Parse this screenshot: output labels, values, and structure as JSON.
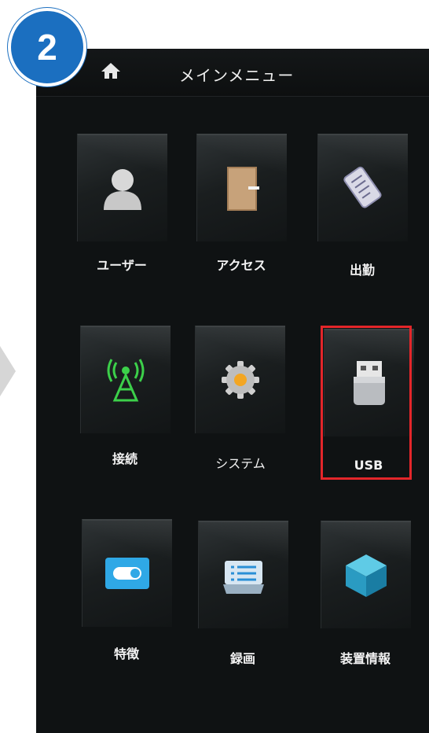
{
  "step_badge": "2",
  "topbar": {
    "title": "メインメニュー",
    "home_icon": "home-icon"
  },
  "menu_items": [
    {
      "label": "ユーザー",
      "icon": "user-icon"
    },
    {
      "label": "アクセス",
      "icon": "door-icon"
    },
    {
      "label": "出勤",
      "icon": "scroll-icon"
    },
    {
      "label": "接続",
      "icon": "antenna-icon"
    },
    {
      "label": "システム",
      "icon": "gear-icon"
    },
    {
      "label": "USB",
      "icon": "usb-drive-icon",
      "highlighted": true
    },
    {
      "label": "特徴",
      "icon": "toggle-icon"
    },
    {
      "label": "録画",
      "icon": "list-icon"
    },
    {
      "label": "装置情報",
      "icon": "cube-icon"
    }
  ],
  "colors": {
    "badge": "#1b6fc0",
    "highlight": "#e3262a",
    "screen_bg": "#0f1213"
  }
}
